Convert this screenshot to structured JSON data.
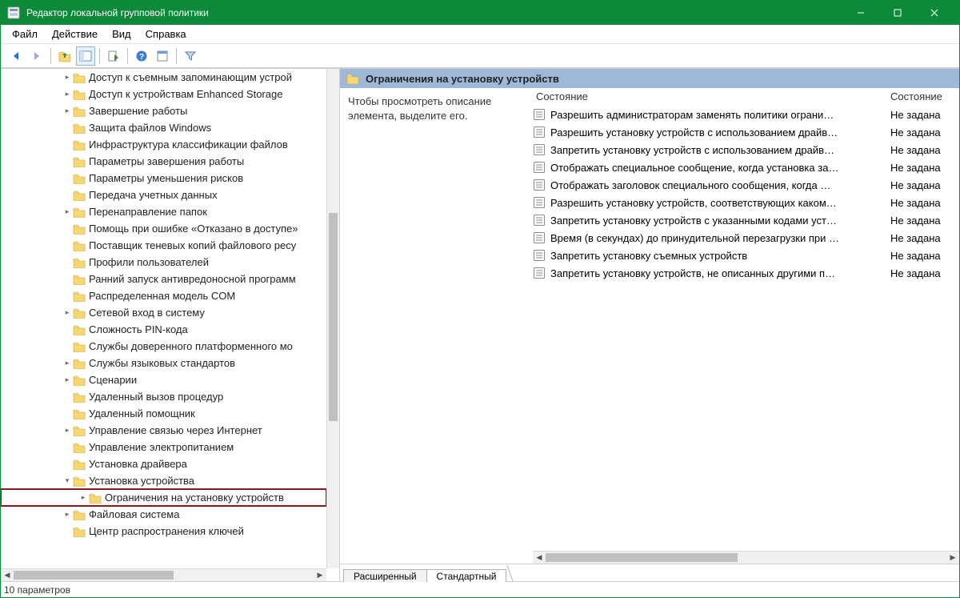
{
  "title": "Редактор локальной групповой политики",
  "menu": {
    "file": "Файл",
    "action": "Действие",
    "view": "Вид",
    "help": "Справка"
  },
  "description_hint": "Чтобы просмотреть описание элемента, выделите его.",
  "columns": {
    "name_col": "Состояние",
    "state_col": "Состояние"
  },
  "right_header": "Ограничения на установку устройств",
  "tabs": {
    "extended": "Расширенный",
    "standard": "Стандартный"
  },
  "status": "10 параметров",
  "tree": [
    {
      "indent": 76,
      "exp": ">",
      "label": "Доступ к съемным запоминающим устрой"
    },
    {
      "indent": 76,
      "exp": ">",
      "label": "Доступ к устройствам Enhanced Storage"
    },
    {
      "indent": 76,
      "exp": ">",
      "label": "Завершение работы"
    },
    {
      "indent": 76,
      "exp": "",
      "label": "Защита файлов Windows"
    },
    {
      "indent": 76,
      "exp": "",
      "label": "Инфраструктура классификации файлов"
    },
    {
      "indent": 76,
      "exp": "",
      "label": "Параметры завершения работы"
    },
    {
      "indent": 76,
      "exp": "",
      "label": "Параметры уменьшения рисков"
    },
    {
      "indent": 76,
      "exp": "",
      "label": "Передача учетных данных"
    },
    {
      "indent": 76,
      "exp": ">",
      "label": "Перенаправление папок"
    },
    {
      "indent": 76,
      "exp": "",
      "label": "Помощь при ошибке «Отказано в доступе»"
    },
    {
      "indent": 76,
      "exp": "",
      "label": "Поставщик теневых копий файлового ресу"
    },
    {
      "indent": 76,
      "exp": "",
      "label": "Профили пользователей"
    },
    {
      "indent": 76,
      "exp": "",
      "label": "Ранний запуск антивредоносной программ"
    },
    {
      "indent": 76,
      "exp": "",
      "label": "Распределенная модель COM"
    },
    {
      "indent": 76,
      "exp": ">",
      "label": "Сетевой вход в систему"
    },
    {
      "indent": 76,
      "exp": "",
      "label": "Сложность PIN-кода"
    },
    {
      "indent": 76,
      "exp": "",
      "label": "Службы доверенного платформенного мо"
    },
    {
      "indent": 76,
      "exp": ">",
      "label": "Службы языковых стандартов"
    },
    {
      "indent": 76,
      "exp": ">",
      "label": "Сценарии"
    },
    {
      "indent": 76,
      "exp": "",
      "label": "Удаленный вызов процедур"
    },
    {
      "indent": 76,
      "exp": "",
      "label": "Удаленный помощник"
    },
    {
      "indent": 76,
      "exp": ">",
      "label": "Управление связью через Интернет"
    },
    {
      "indent": 76,
      "exp": "",
      "label": "Управление электропитанием"
    },
    {
      "indent": 76,
      "exp": "",
      "label": "Установка драйвера"
    },
    {
      "indent": 76,
      "exp": "v",
      "label": "Установка устройства"
    },
    {
      "indent": 96,
      "exp": ">",
      "label": "Ограничения на установку устройств",
      "highlight": true
    },
    {
      "indent": 76,
      "exp": ">",
      "label": "Файловая система"
    },
    {
      "indent": 76,
      "exp": "",
      "label": "Центр распространения ключей"
    }
  ],
  "policies": [
    {
      "name": "Разрешить администраторам заменять политики ограни…",
      "state": "Не задана"
    },
    {
      "name": "Разрешить установку устройств с использованием драйв…",
      "state": "Не задана"
    },
    {
      "name": "Запретить установку устройств с использованием драйв…",
      "state": "Не задана"
    },
    {
      "name": "Отображать специальное сообщение, когда установка за…",
      "state": "Не задана"
    },
    {
      "name": "Отображать заголовок специального сообщения, когда …",
      "state": "Не задана"
    },
    {
      "name": "Разрешить установку устройств, соответствующих каком…",
      "state": "Не задана"
    },
    {
      "name": "Запретить установку устройств с указанными кодами уст…",
      "state": "Не задана"
    },
    {
      "name": "Время (в секундах) до принудительной перезагрузки при …",
      "state": "Не задана"
    },
    {
      "name": "Запретить установку съемных устройств",
      "state": "Не задана"
    },
    {
      "name": "Запретить установку устройств, не описанных другими п…",
      "state": "Не задана"
    }
  ]
}
